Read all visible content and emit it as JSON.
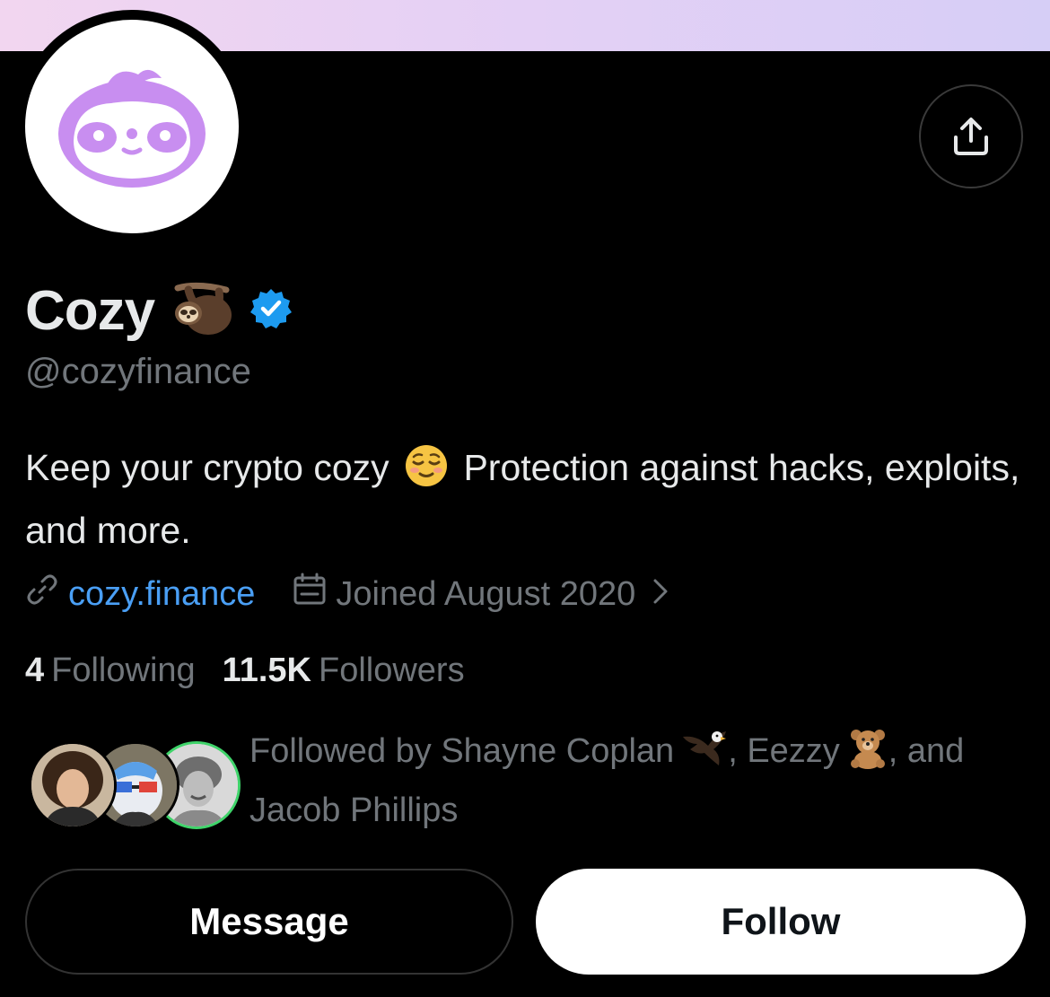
{
  "profile": {
    "display_name": "Cozy",
    "name_emoji": "sloth-emoji",
    "verified_badge": "verified-badge-icon",
    "handle": "@cozyfinance",
    "bio_part1": "Keep your crypto cozy",
    "bio_emoji": "relieved-face-emoji",
    "bio_part2": "Protection against hacks, exploits, and more.",
    "website": "cozy.finance",
    "joined": "Joined August 2020"
  },
  "stats": {
    "following_count": "4",
    "following_label": "Following",
    "followers_count": "11.5K",
    "followers_label": "Followers"
  },
  "followed_by": {
    "prefix": "Followed by ",
    "person1": "Shayne Coplan",
    "person1_emoji": "eagle-emoji",
    "sep1": ", ",
    "person2": "Eezzy",
    "person2_emoji": "teddy-bear-emoji",
    "sep2": ", and",
    "person3": "Jacob Phillips"
  },
  "actions": {
    "message_label": "Message",
    "follow_label": "Follow"
  },
  "icons": {
    "share": "share-icon",
    "link": "link-icon",
    "calendar": "calendar-icon",
    "chevron": "chevron-right-icon"
  },
  "colors": {
    "background": "#000000",
    "primary_text": "#e7e9ea",
    "secondary_text": "#71767b",
    "link": "#4a9ff5",
    "verified": "#1d9bf0",
    "logo_purple": "#c88ef0",
    "banner_start": "#f2d6f0",
    "banner_end": "#d6cef6"
  }
}
